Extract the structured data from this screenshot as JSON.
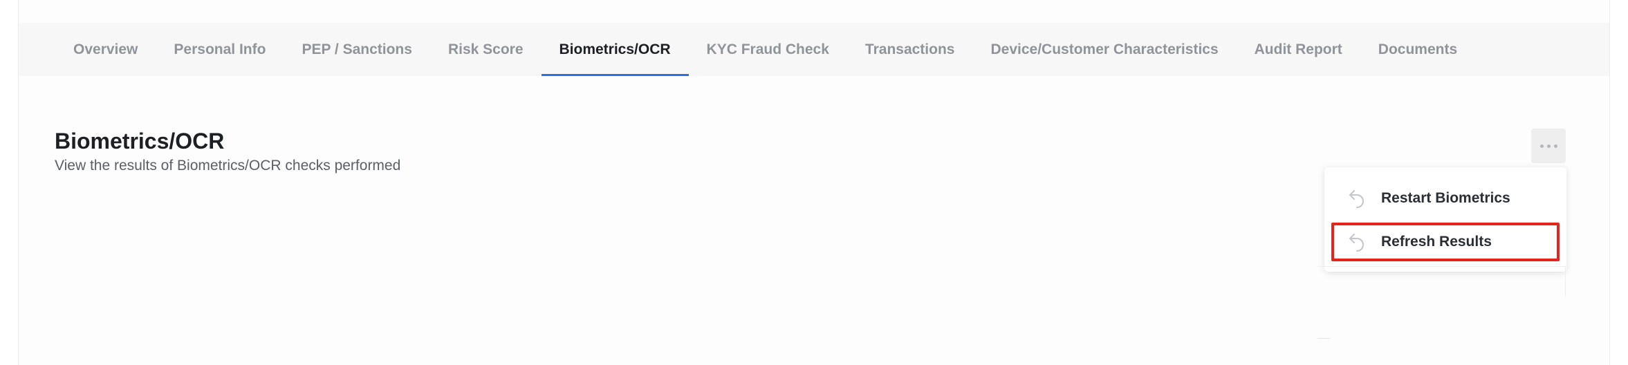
{
  "tabs": [
    {
      "label": "Overview"
    },
    {
      "label": "Personal Info"
    },
    {
      "label": "PEP / Sanctions"
    },
    {
      "label": "Risk Score"
    },
    {
      "label": "Biometrics/OCR"
    },
    {
      "label": "KYC Fraud Check"
    },
    {
      "label": "Transactions"
    },
    {
      "label": "Device/Customer Characteristics"
    },
    {
      "label": "Audit Report"
    },
    {
      "label": "Documents"
    }
  ],
  "active_tab": "Biometrics/OCR",
  "section": {
    "title": "Biometrics/OCR",
    "subtitle": "View the results of Biometrics/OCR checks performed"
  },
  "menu": {
    "trigger_icon": "more-horizontal-icon",
    "items": [
      {
        "label": "Restart Biometrics",
        "icon": "undo-arrow-icon"
      },
      {
        "label": "Refresh Results",
        "icon": "undo-arrow-icon"
      }
    ]
  },
  "colors": {
    "accent": "#2d6ee0",
    "highlight": "#e5251c",
    "tab_inactive": "#8f939a",
    "text_dark": "#1c1f24"
  }
}
